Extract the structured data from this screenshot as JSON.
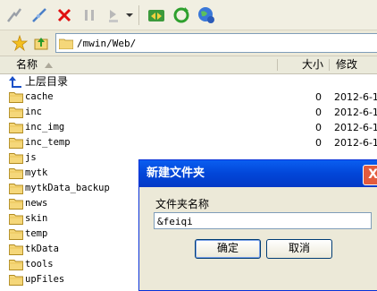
{
  "toolbar": {
    "buttons": [
      {
        "icon": "connect-icon"
      },
      {
        "icon": "disconnect-icon"
      },
      {
        "icon": "stop-icon"
      },
      {
        "icon": "pause-icon"
      },
      {
        "icon": "transfer-icon"
      },
      {
        "icon": "sync-icon"
      },
      {
        "icon": "refresh-icon"
      },
      {
        "icon": "globe-icon"
      }
    ]
  },
  "address": {
    "path": "/mwin/Web/"
  },
  "columns": {
    "name": "名称",
    "size": "大小",
    "modified": "修改"
  },
  "parent_dir": "上层目录",
  "files": [
    {
      "name": "cache",
      "size": "0",
      "date": "2012-6-1"
    },
    {
      "name": "inc",
      "size": "0",
      "date": "2012-6-1"
    },
    {
      "name": "inc_img",
      "size": "0",
      "date": "2012-6-1"
    },
    {
      "name": "inc_temp",
      "size": "0",
      "date": "2012-6-1"
    },
    {
      "name": "js",
      "size": "",
      "date": ""
    },
    {
      "name": "mytk",
      "size": "",
      "date": ""
    },
    {
      "name": "mytkData_backup",
      "size": "",
      "date": ""
    },
    {
      "name": "news",
      "size": "",
      "date": ""
    },
    {
      "name": "skin",
      "size": "",
      "date": ""
    },
    {
      "name": "temp",
      "size": "",
      "date": ""
    },
    {
      "name": "tkData",
      "size": "",
      "date": ""
    },
    {
      "name": "tools",
      "size": "",
      "date": ""
    },
    {
      "name": "upFiles",
      "size": "0",
      "date": "2012-6-1"
    }
  ],
  "dialog": {
    "title": "新建文件夹",
    "label": "文件夹名称",
    "input_value": "&feiqi",
    "ok": "确定",
    "cancel": "取消",
    "close": "X"
  },
  "colors": {
    "titlebar": "#0a5ef0",
    "close_button": "#e35b3d",
    "folder": "#f5d77a"
  }
}
